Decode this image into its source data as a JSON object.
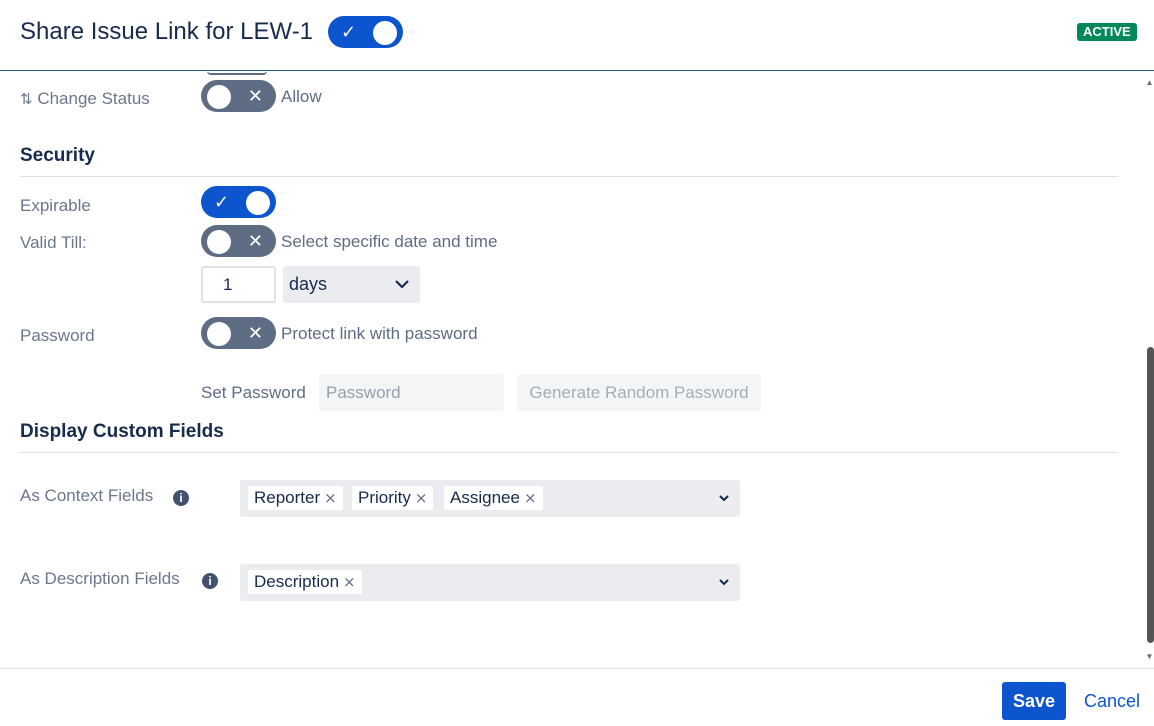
{
  "header": {
    "title": "Share Issue Link for LEW-1",
    "status_badge": "ACTIVE"
  },
  "fields": {
    "change_status": {
      "label": "Change Status",
      "toggle_text": "Allow",
      "enabled": false
    }
  },
  "security": {
    "heading": "Security",
    "expirable": {
      "label": "Expirable",
      "enabled": true
    },
    "valid_till": {
      "label": "Valid Till:",
      "toggle_text": "Select specific date and time",
      "enabled": false,
      "amount": "1",
      "unit": "days"
    },
    "password": {
      "label": "Password",
      "toggle_text": "Protect link with password",
      "enabled": false,
      "set_label": "Set Password",
      "placeholder": "Password",
      "generate_label": "Generate Random Password"
    }
  },
  "custom_fields": {
    "heading": "Display Custom Fields",
    "context": {
      "label": "As Context Fields",
      "chips": [
        "Reporter",
        "Priority",
        "Assignee"
      ]
    },
    "description": {
      "label": "As Description Fields",
      "chips": [
        "Description"
      ]
    }
  },
  "icons": {
    "check": "✓",
    "cross": "✕",
    "chip_remove": "×",
    "chevron": "⌄",
    "sort": "⇅",
    "info": "i"
  },
  "footer": {
    "save_label": "Save",
    "cancel_label": "Cancel"
  },
  "colors": {
    "primary": "#0c55cf",
    "active_badge": "#00875a",
    "toggle_off": "#5e6c84"
  }
}
